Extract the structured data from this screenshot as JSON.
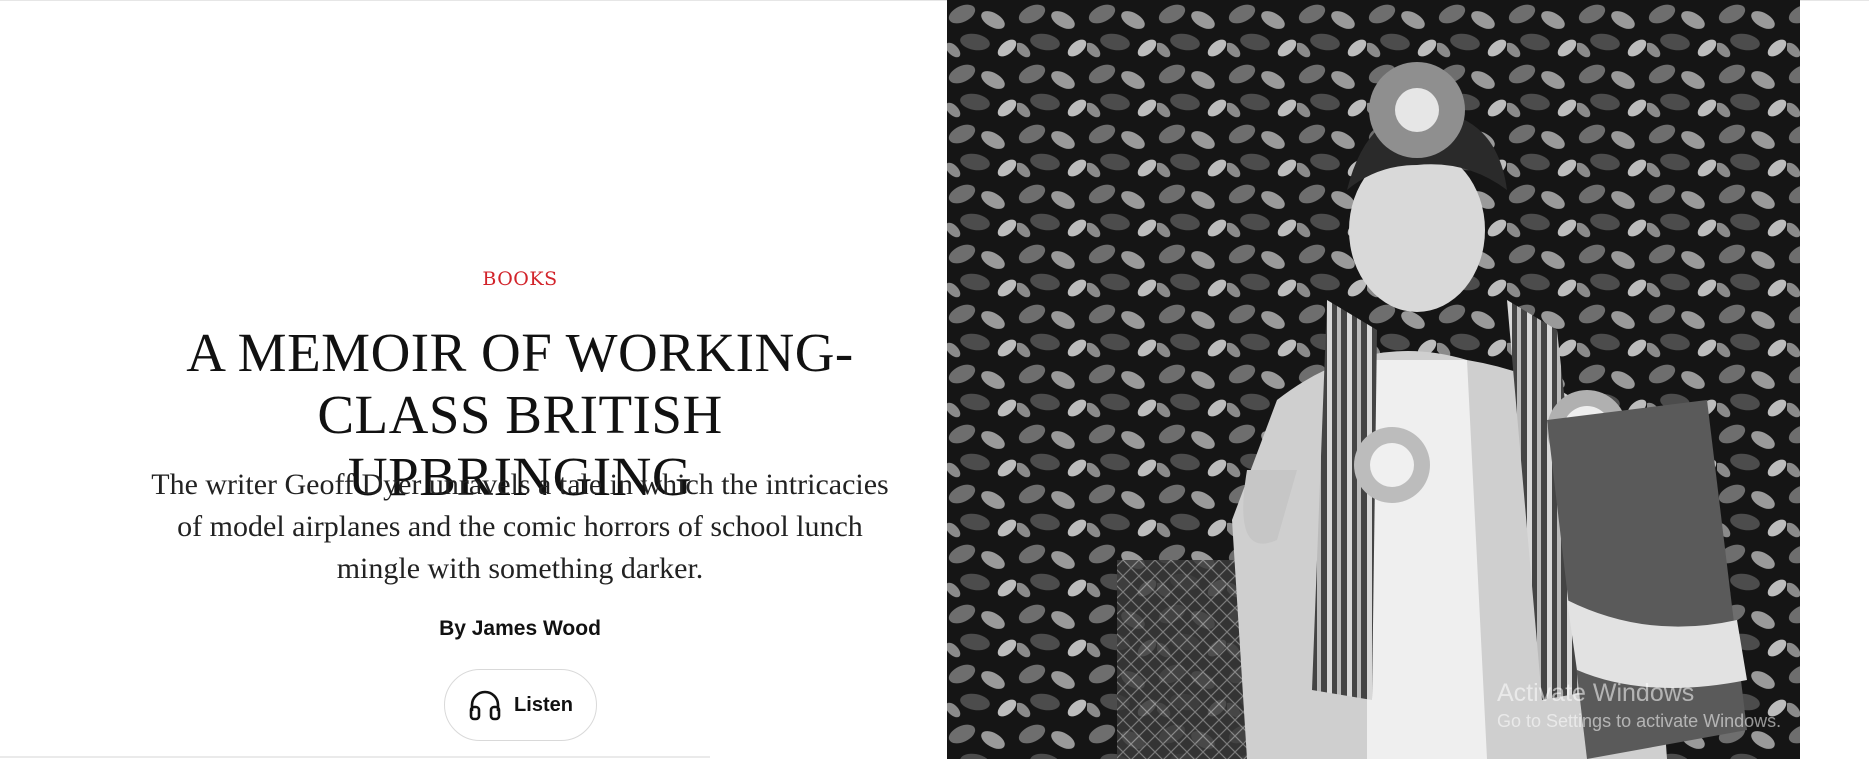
{
  "article": {
    "rubric": "Books",
    "headline": "A Memoir of Working-Class British Upbringing",
    "dek": "The writer Geoff Dyer unravels a tale in which the intricacies of model airplanes and the comic horrors of school lunch mingle with something darker.",
    "byline": "By James Wood",
    "listen_label": "Listen",
    "listen_icon": "headphones-icon",
    "rubric_color": "#d2232a"
  },
  "hero": {
    "description_icon": "photo"
  },
  "os_watermark": {
    "title": "Activate Windows",
    "subtitle": "Go to Settings to activate Windows."
  }
}
